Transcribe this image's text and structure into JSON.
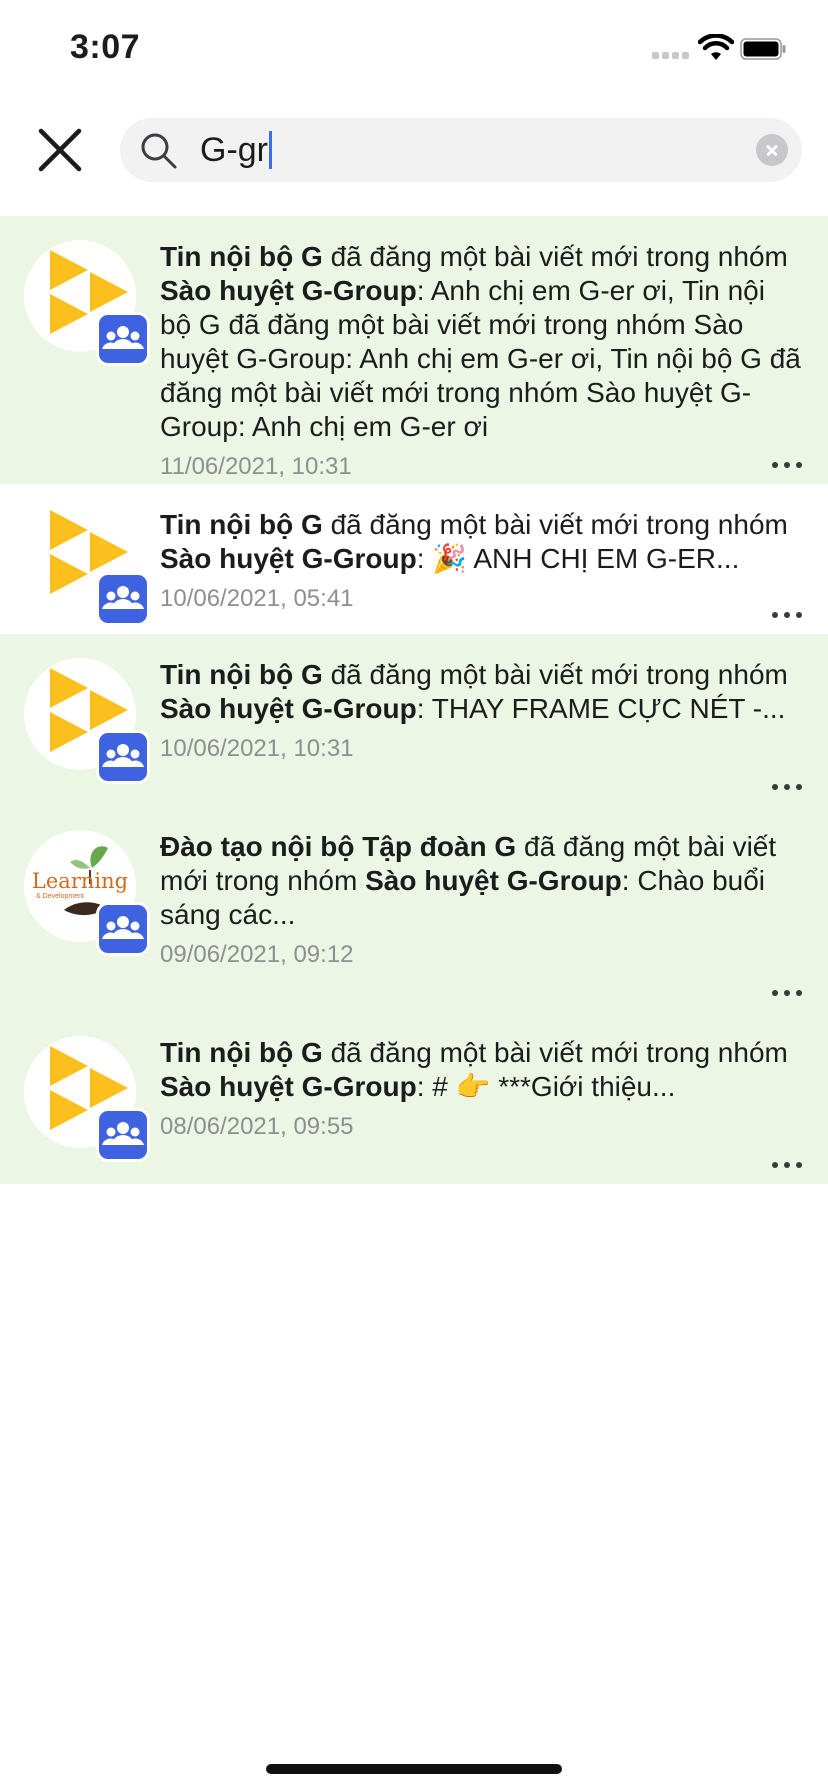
{
  "status_bar": {
    "time": "3:07"
  },
  "search": {
    "query": "G-gr"
  },
  "notifications": [
    {
      "sender": "Tin nội bộ G",
      "action": " đã đăng một bài viết mới trong nhóm ",
      "group": "Sào huyệt G-Group",
      "excerpt": ": Anh chị em G-er ơi, Tin nội bộ G đã đăng một bài viết mới trong nhóm Sào huyệt G-Group: Anh chị em G-er ơi, Tin nội bộ G đã đăng một bài viết mới trong nhóm Sào huyệt G-Group: Anh chị em G-er ơi",
      "timestamp": "11/06/2021, 10:31",
      "unread": true,
      "avatar": "play-logo"
    },
    {
      "sender": "Tin nội bộ G",
      "action": " đã đăng một bài viết mới trong nhóm ",
      "group": "Sào huyệt G-Group",
      "excerpt": ": 🎉 ANH CHỊ EM G-ER...",
      "timestamp": "10/06/2021, 05:41",
      "unread": false,
      "avatar": "play-logo"
    },
    {
      "sender": "Tin nội bộ G",
      "action": " đã đăng một bài viết mới trong nhóm ",
      "group": "Sào huyệt G-Group",
      "excerpt": ": THAY FRAME CỰC NÉT -...",
      "timestamp": "10/06/2021, 10:31",
      "unread": true,
      "avatar": "play-logo"
    },
    {
      "sender": "Đào tạo nội bộ Tập đoàn G",
      "action": " đã đăng một bài viết mới trong nhóm ",
      "group": "Sào huyệt G-Group",
      "excerpt": ": Chào buổi sáng các...",
      "timestamp": "09/06/2021, 09:12",
      "unread": true,
      "avatar": "learning-logo",
      "avatar_text": "Learning",
      "avatar_subtext": "& Development"
    },
    {
      "sender": "Tin nội bộ G",
      "action": " đã đăng một bài viết mới trong nhóm ",
      "group": "Sào huyệt G-Group",
      "excerpt": ": # 👉 ***Giới thiệu...",
      "timestamp": "08/06/2021, 09:55",
      "unread": true,
      "avatar": "play-logo"
    }
  ],
  "icons": {
    "close": "close-icon",
    "search": "search-icon",
    "clear": "clear-icon",
    "group_badge": "group-icon",
    "more": "more-icon"
  },
  "colors": {
    "unread_bg": "#ebf6e5",
    "badge": "#3f63e0",
    "logo_yellow": "#fbbf1e",
    "caret": "#3a6cf4"
  }
}
